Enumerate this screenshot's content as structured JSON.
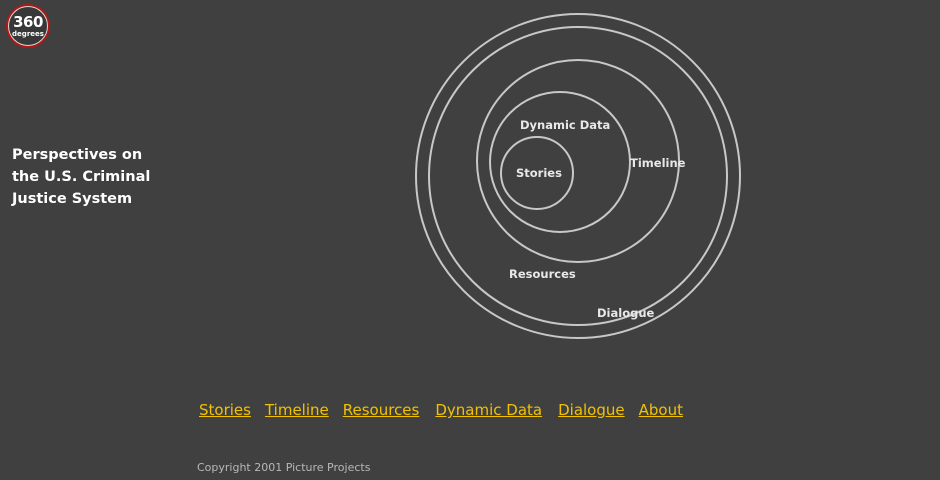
{
  "logo": {
    "number": "360",
    "word": "degrees"
  },
  "tagline": {
    "lines": [
      "Perspectives on",
      "the U.S. Criminal",
      "Justice System"
    ]
  },
  "diagram": {
    "rings": {
      "stories": "Stories",
      "dynamic_data": "Dynamic Data",
      "timeline": "Timeline",
      "resources": "Resources",
      "dialogue": "Dialogue"
    }
  },
  "nav": {
    "links": [
      "Stories",
      "Timeline",
      "Resources",
      "Dynamic Data",
      "Dialogue",
      "About"
    ]
  },
  "footer": {
    "copyright": "Copyright 2001 Picture Projects"
  },
  "colors": {
    "background": "#404040",
    "link": "#f2c200",
    "ring": "#c8c8c8",
    "logo_ring": "#b01818"
  }
}
